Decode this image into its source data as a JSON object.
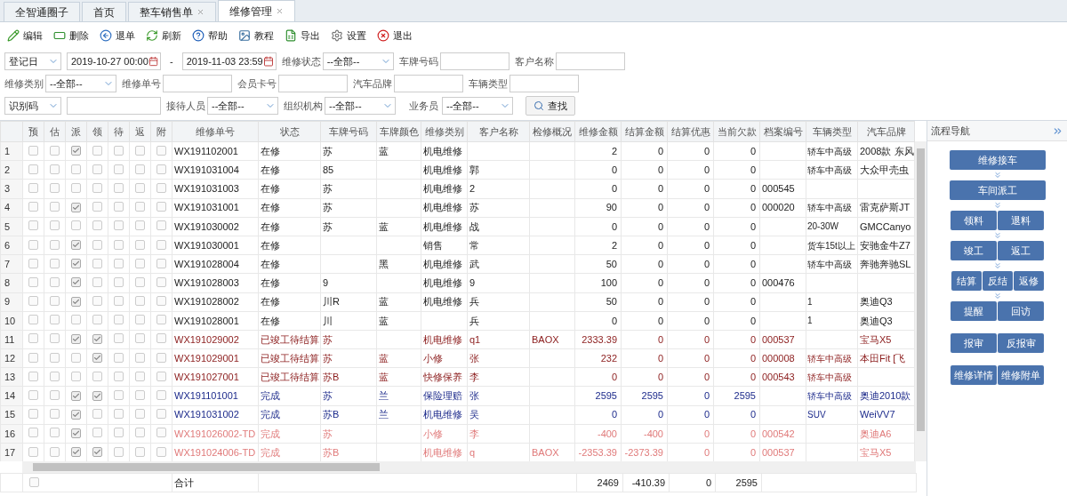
{
  "tabs": [
    {
      "label": "全智通圈子",
      "closable": false,
      "selected": false
    },
    {
      "label": "首页",
      "closable": false,
      "selected": false
    },
    {
      "label": "整车销售单",
      "closable": true,
      "selected": false
    },
    {
      "label": "维修管理",
      "closable": true,
      "selected": true
    }
  ],
  "toolbar": [
    {
      "label": "编辑"
    },
    {
      "label": "删除"
    },
    {
      "label": "退单"
    },
    {
      "label": "刷新"
    },
    {
      "label": "帮助"
    },
    {
      "label": "教程"
    },
    {
      "label": "导出"
    },
    {
      "label": "设置"
    },
    {
      "label": "退出"
    }
  ],
  "filters": [
    [
      {
        "kind": "select",
        "value": "登记日"
      },
      {
        "kind": "date",
        "value": "2019-10-27 00:00"
      },
      {
        "kind": "dash",
        "text": "-"
      },
      {
        "kind": "date",
        "value": "2019-11-03 23:59"
      },
      {
        "kind": "select",
        "label": "维修状态",
        "value": "--全部--"
      },
      {
        "kind": "input",
        "label": "车牌号码"
      },
      {
        "kind": "input",
        "label": "客户名称"
      }
    ],
    [
      {
        "kind": "select",
        "label": "维修类别",
        "value": "--全部--"
      },
      {
        "kind": "input",
        "label": "维修单号"
      },
      {
        "kind": "input",
        "label": "会员卡号"
      },
      {
        "kind": "input",
        "label": "汽车品牌"
      },
      {
        "kind": "input",
        "label": "车辆类型"
      }
    ],
    [
      {
        "kind": "select",
        "value": "识别码"
      },
      {
        "kind": "input"
      },
      {
        "kind": "select",
        "label": "接待人员",
        "value": "--全部--"
      },
      {
        "kind": "select",
        "label": "组织机构",
        "value": "--全部--"
      },
      {
        "kind": "select",
        "label": "业务员",
        "value": "--全部--"
      },
      {
        "kind": "button",
        "text": "查找"
      }
    ]
  ],
  "table": {
    "check_columns": [
      "预",
      "估",
      "派",
      "领",
      "待",
      "返",
      "附"
    ],
    "columns": [
      "维修单号",
      "状态",
      "车牌号码",
      "车牌颜色",
      "维修类别",
      "客户名称",
      "检修概况",
      "维修金额",
      "结算金额",
      "结算优惠",
      "当前欠款",
      "档案编号",
      "车辆类型",
      "汽车品牌"
    ],
    "rows": [
      {
        "no": "1",
        "kind": "repair",
        "checks": [
          false,
          false,
          true,
          false,
          false,
          false,
          false
        ],
        "cells": [
          "WX191102001",
          "在修",
          "苏",
          "蓝",
          "机电维修",
          "",
          "",
          "2",
          "0",
          "0",
          "0",
          "",
          "轿车中高级",
          "2008款 东风"
        ]
      },
      {
        "no": "2",
        "kind": "repair",
        "checks": [
          false,
          false,
          false,
          false,
          false,
          false,
          false
        ],
        "cells": [
          "WX191031004",
          "在修",
          "85",
          "",
          "机电维修",
          "郭",
          "",
          "0",
          "0",
          "0",
          "0",
          "",
          "轿车中高级",
          "大众甲壳虫"
        ]
      },
      {
        "no": "3",
        "kind": "repair",
        "checks": [
          false,
          false,
          false,
          false,
          false,
          false,
          false
        ],
        "cells": [
          "WX191031003",
          "在修",
          "苏",
          "",
          "机电维修",
          "2",
          "",
          "0",
          "0",
          "0",
          "0",
          "000545",
          "",
          ""
        ]
      },
      {
        "no": "4",
        "kind": "repair",
        "checks": [
          false,
          false,
          true,
          false,
          false,
          false,
          false
        ],
        "cells": [
          "WX191031001",
          "在修",
          "苏",
          "",
          "机电维修",
          "苏",
          "",
          "90",
          "0",
          "0",
          "0",
          "000020",
          "轿车中高级",
          "雷克萨斯JT"
        ]
      },
      {
        "no": "5",
        "kind": "repair",
        "checks": [
          false,
          false,
          false,
          false,
          false,
          false,
          false
        ],
        "cells": [
          "WX191030002",
          "在修",
          "苏",
          "蓝",
          "机电维修",
          "战",
          "",
          "0",
          "0",
          "0",
          "0",
          "",
          "20-30W",
          "GMCCanyo"
        ]
      },
      {
        "no": "6",
        "kind": "repair",
        "checks": [
          false,
          false,
          true,
          false,
          false,
          false,
          false
        ],
        "cells": [
          "WX191030001",
          "在修",
          "",
          "",
          "销售",
          "常",
          "",
          "2",
          "0",
          "0",
          "0",
          "",
          "货车15t以上",
          "安驰金牛Z7"
        ]
      },
      {
        "no": "7",
        "kind": "repair",
        "checks": [
          false,
          false,
          true,
          false,
          false,
          false,
          false
        ],
        "cells": [
          "WX191028004",
          "在修",
          "",
          "黑",
          "机电维修",
          "武",
          "",
          "50",
          "0",
          "0",
          "0",
          "",
          "轿车中高级",
          "奔驰奔驰SL"
        ]
      },
      {
        "no": "8",
        "kind": "repair",
        "checks": [
          false,
          false,
          true,
          false,
          false,
          false,
          false
        ],
        "cells": [
          "WX191028003",
          "在修",
          "9",
          "",
          "机电维修",
          "9",
          "",
          "100",
          "0",
          "0",
          "0",
          "000476",
          "",
          ""
        ]
      },
      {
        "no": "9",
        "kind": "repair",
        "checks": [
          false,
          false,
          true,
          false,
          false,
          false,
          false
        ],
        "cells": [
          "WX191028002",
          "在修",
          "川R",
          "蓝",
          "机电维修",
          "兵",
          "",
          "50",
          "0",
          "0",
          "0",
          "",
          "1",
          "奥迪Q3"
        ]
      },
      {
        "no": "10",
        "kind": "repair",
        "checks": [
          false,
          false,
          false,
          false,
          false,
          false,
          false
        ],
        "cells": [
          "WX191028001",
          "在修",
          "川",
          "蓝",
          "",
          "兵",
          "",
          "0",
          "0",
          "0",
          "0",
          "",
          "1",
          "奥迪Q3"
        ]
      },
      {
        "no": "11",
        "kind": "pending",
        "checks": [
          false,
          false,
          true,
          true,
          false,
          false,
          false
        ],
        "cells": [
          "WX191029002",
          "已竣工待结算",
          "苏",
          "",
          "机电维修",
          "q1",
          "BAOX",
          "2333.39",
          "0",
          "0",
          "0",
          "000537",
          "",
          "宝马X5"
        ]
      },
      {
        "no": "12",
        "kind": "pending",
        "checks": [
          false,
          false,
          false,
          true,
          false,
          false,
          false
        ],
        "cells": [
          "WX191029001",
          "已竣工待结算",
          "苏",
          "蓝",
          "小修",
          "张",
          "",
          "232",
          "0",
          "0",
          "0",
          "000008",
          "轿车中高级",
          "本田Fit [飞"
        ]
      },
      {
        "no": "13",
        "kind": "pending",
        "checks": [
          false,
          false,
          false,
          false,
          false,
          false,
          false
        ],
        "cells": [
          "WX191027001",
          "已竣工待结算",
          "苏B",
          "蓝",
          "快修保养",
          "李",
          "",
          "0",
          "0",
          "0",
          "0",
          "000543",
          "轿车中高级",
          ""
        ]
      },
      {
        "no": "14",
        "kind": "done",
        "checks": [
          false,
          false,
          true,
          true,
          false,
          false,
          false
        ],
        "cells": [
          "WX191101001",
          "完成",
          "苏",
          "兰",
          "保险理赔",
          "张",
          "",
          "2595",
          "2595",
          "0",
          "2595",
          "",
          "轿车中高级",
          "奥迪2010款"
        ]
      },
      {
        "no": "15",
        "kind": "done",
        "checks": [
          false,
          false,
          true,
          false,
          false,
          false,
          false
        ],
        "cells": [
          "WX191031002",
          "完成",
          "苏B",
          "兰",
          "机电维修",
          "吴",
          "",
          "0",
          "0",
          "0",
          "0",
          "",
          "SUV",
          "WeiVV7"
        ]
      },
      {
        "no": "16",
        "kind": "refund",
        "checks": [
          false,
          false,
          true,
          false,
          false,
          false,
          false
        ],
        "cells": [
          "WX191026002-TD",
          "完成",
          "苏",
          "",
          "小修",
          "李",
          "",
          "-400",
          "-400",
          "0",
          "0",
          "000542",
          "",
          "奥迪A6"
        ]
      },
      {
        "no": "17",
        "kind": "refund",
        "checks": [
          false,
          false,
          true,
          true,
          false,
          false,
          false
        ],
        "cells": [
          "WX191024006-TD",
          "完成",
          "苏B",
          "",
          "机电维修",
          "q",
          "BAOX",
          "-2353.39",
          "-2373.39",
          "0",
          "0",
          "000537",
          "",
          "宝马X5"
        ]
      }
    ],
    "footer": {
      "checked": false,
      "label": "合计",
      "totals": [
        "2469",
        "-410.39",
        "0",
        "2595"
      ]
    }
  },
  "flow": {
    "title": "流程导航",
    "groups": [
      {
        "buttons": [
          "维修接车"
        ],
        "arrow": true
      },
      {
        "buttons": [
          "车间派工"
        ],
        "arrow": true
      },
      {
        "buttons": [
          "领料",
          "退料"
        ],
        "arrow": true
      },
      {
        "buttons": [
          "竣工",
          "返工"
        ],
        "arrow": true
      },
      {
        "buttons": [
          "结算",
          "反结",
          "返修"
        ],
        "arrow": true
      },
      {
        "buttons": [
          "提醒",
          "回访"
        ],
        "arrow": false
      },
      {
        "buttons": [
          "报审",
          "反报审"
        ],
        "arrow": false
      },
      {
        "buttons": [
          "维修详情",
          "维修附单"
        ],
        "arrow": false
      }
    ]
  }
}
